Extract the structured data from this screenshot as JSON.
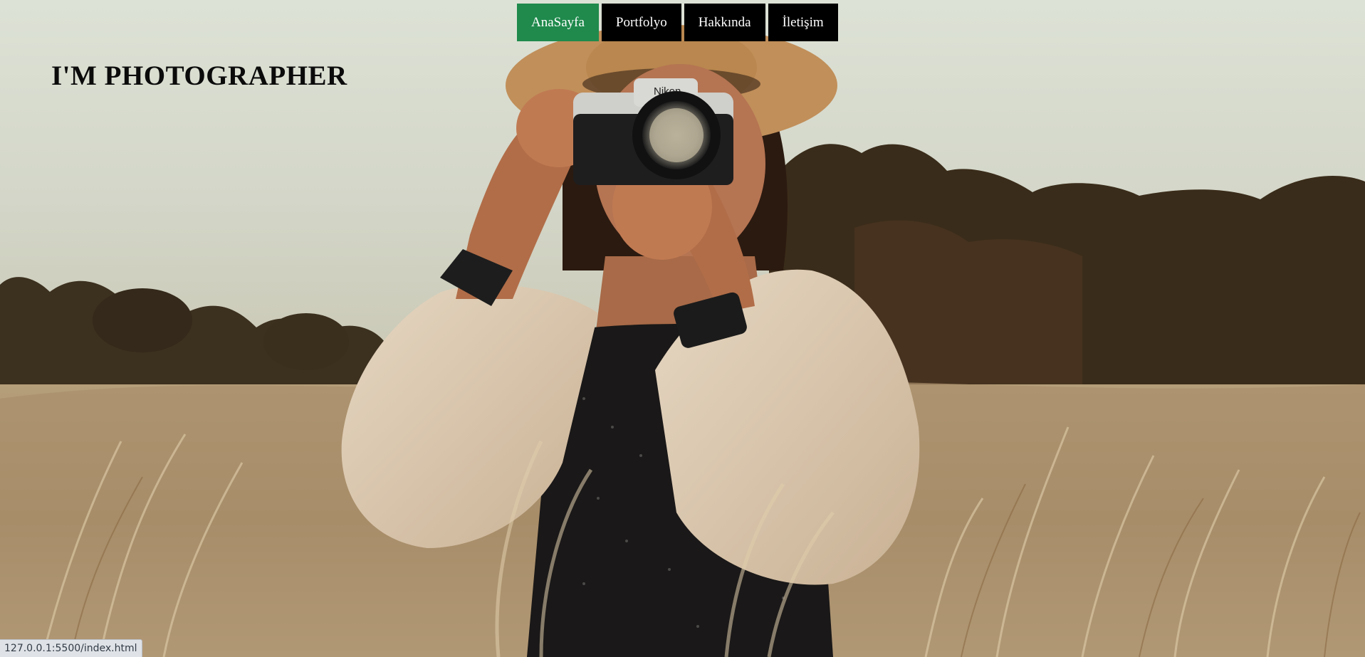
{
  "nav": {
    "items": [
      {
        "label": "AnaSayfa",
        "active": true
      },
      {
        "label": "Portfolyo",
        "active": false
      },
      {
        "label": "Hakkında",
        "active": false
      },
      {
        "label": "İletişim",
        "active": false
      }
    ],
    "active_color": "#1f8a4c",
    "inactive_color": "#000000"
  },
  "hero": {
    "headline": "I'M PHOTOGRAPHER",
    "camera_brand": "Nikon"
  },
  "status_bar": {
    "url": "127.0.0.1:5500/index.html"
  }
}
